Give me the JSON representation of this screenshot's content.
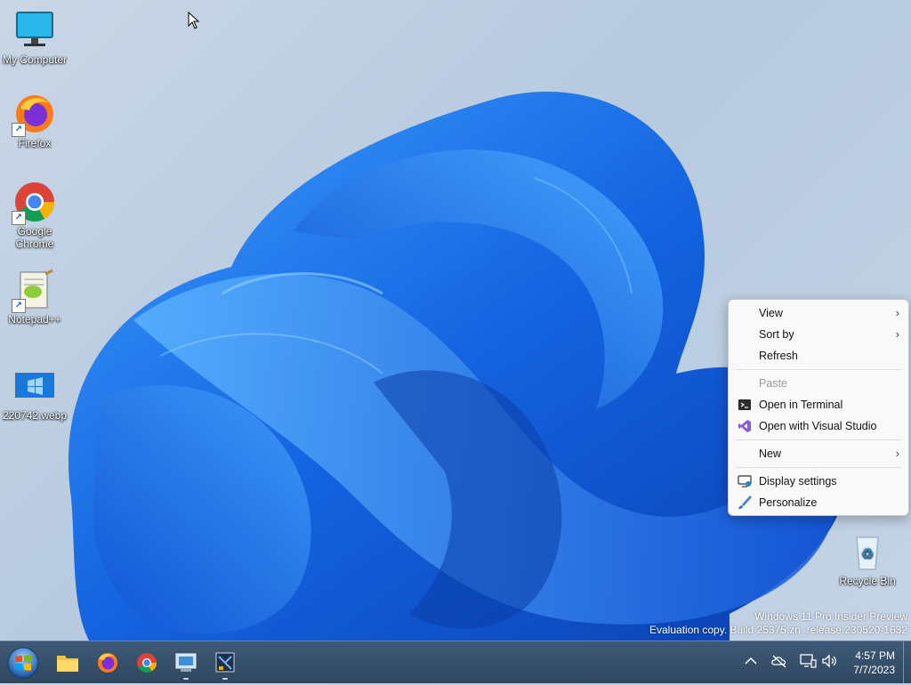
{
  "desktop": {
    "icons": [
      {
        "label": "My Computer",
        "icon": "monitor-icon"
      },
      {
        "label": "Firefox",
        "icon": "firefox-icon"
      },
      {
        "label": "Google Chrome",
        "icon": "chrome-icon"
      },
      {
        "label": "Notepad++",
        "icon": "notepadpp-icon"
      },
      {
        "label": "220742.webp",
        "icon": "image-file-icon"
      },
      {
        "label": "Recycle Bin",
        "icon": "recycle-bin-icon"
      }
    ],
    "watermark": {
      "line1": "Windows 11 Pro Insider Preview",
      "line2": "Evaluation copy. Build 25375.zn_release.230520-1632"
    }
  },
  "context_menu": {
    "view": "View",
    "sort_by": "Sort by",
    "refresh": "Refresh",
    "paste": "Paste",
    "open_terminal": "Open in Terminal",
    "open_vs": "Open with Visual Studio",
    "new": "New",
    "display_settings": "Display settings",
    "personalize": "Personalize"
  },
  "taskbar": {
    "apps": [
      "start-orb-icon",
      "file-explorer-icon",
      "firefox-icon",
      "chrome-icon",
      "remote-desktop-icon",
      "terminal-app-icon"
    ],
    "clock": {
      "time": "4:57 PM",
      "date": "7/7/2023"
    }
  },
  "colors": {
    "taskbar": "#34506c",
    "menu_bg": "#f9f9f9",
    "wallpaper_blue": "#1a6fe8"
  }
}
